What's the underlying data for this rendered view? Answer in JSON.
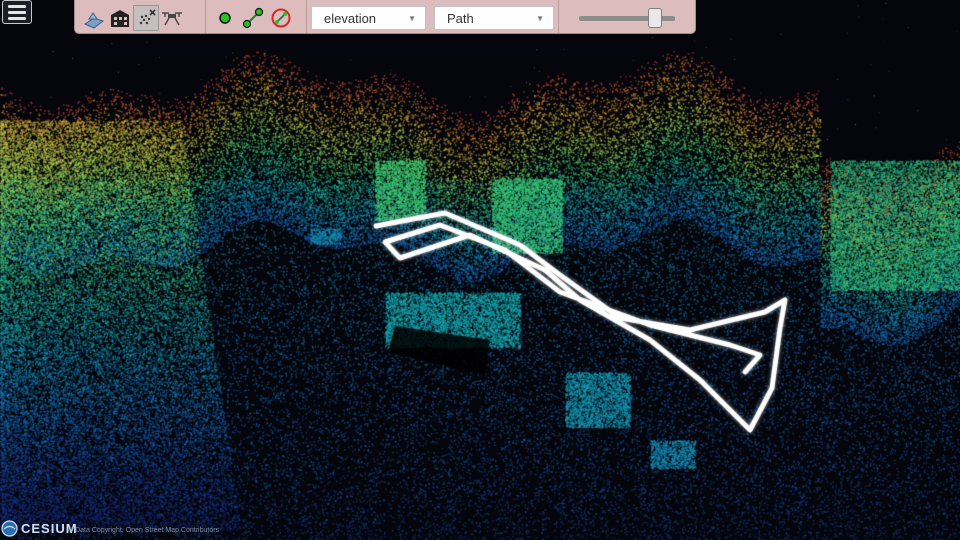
{
  "toolbar": {
    "groups": [
      {
        "name": "Datasets",
        "label": ""
      },
      {
        "name": "Measure",
        "label": ""
      },
      {
        "name": "Map Color",
        "label": ""
      },
      {
        "name": "Path Color",
        "label": ""
      },
      {
        "name": "Point Budget",
        "label": ""
      }
    ],
    "dataset_buttons": [
      {
        "icon": "terrain-layer-icon"
      },
      {
        "icon": "building-layer-icon"
      },
      {
        "icon": "pointcloud-hide-icon",
        "active": true
      },
      {
        "icon": "drone-icon"
      }
    ],
    "measure_buttons": [
      {
        "icon": "point-measure-icon"
      },
      {
        "icon": "line-measure-icon"
      },
      {
        "icon": "clear-measure-icon"
      }
    ],
    "map_color": {
      "value": "elevation"
    },
    "path_color": {
      "value": "Path"
    },
    "point_budget": {
      "level": 0.78
    }
  },
  "logo": {
    "text": "CESIUM"
  },
  "attribution": {
    "text": "© Data Copyright, Open Street Map Contributors"
  },
  "colors": {
    "toolbar_bg": "#dcbcbc",
    "path_line": "#ffffff",
    "elevation_low": "#1a2a8a",
    "elevation_high": "#e23b3b"
  }
}
